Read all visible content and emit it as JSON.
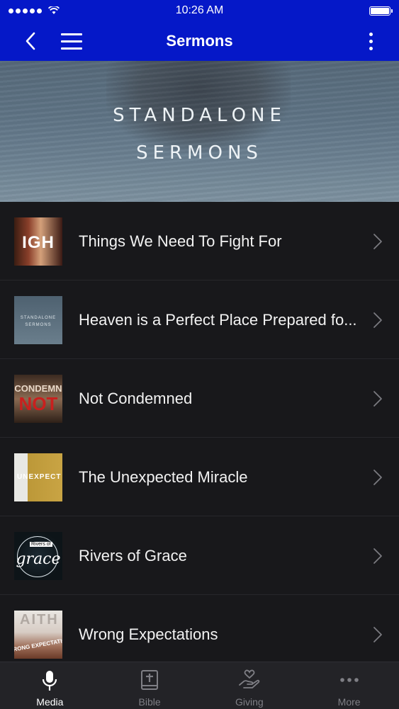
{
  "status_bar": {
    "time": "10:26 AM"
  },
  "nav": {
    "title": "Sermons"
  },
  "hero": {
    "line1": "STANDALONE",
    "line2": "SERMONS"
  },
  "thumbs": {
    "t1": "IGH",
    "t2_a": "STANDALONE",
    "t2_b": "SERMONS",
    "t3_a": "CONDEMN",
    "t3_b": "NOT",
    "t4": "UNEXPECT",
    "t5_a": "Rivers of",
    "t5_b": "grace",
    "t6_a": "AITH",
    "t6_b": "RONG EXPECTATIO"
  },
  "sermons": [
    "Things We Need To Fight For",
    "Heaven is a Perfect Place Prepared fo...",
    "Not Condemned",
    "The Unexpected Miracle",
    "Rivers of Grace",
    "Wrong Expectations"
  ],
  "tabs": [
    {
      "label": "Media",
      "icon": "microphone-icon",
      "active": true
    },
    {
      "label": "Bible",
      "icon": "bible-icon",
      "active": false
    },
    {
      "label": "Giving",
      "icon": "giving-hand-icon",
      "active": false
    },
    {
      "label": "More",
      "icon": "more-dots-icon",
      "active": false
    }
  ],
  "colors": {
    "nav": "#0518c8",
    "background": "#131316",
    "row": "#18181b",
    "tab_bar": "#232327"
  }
}
